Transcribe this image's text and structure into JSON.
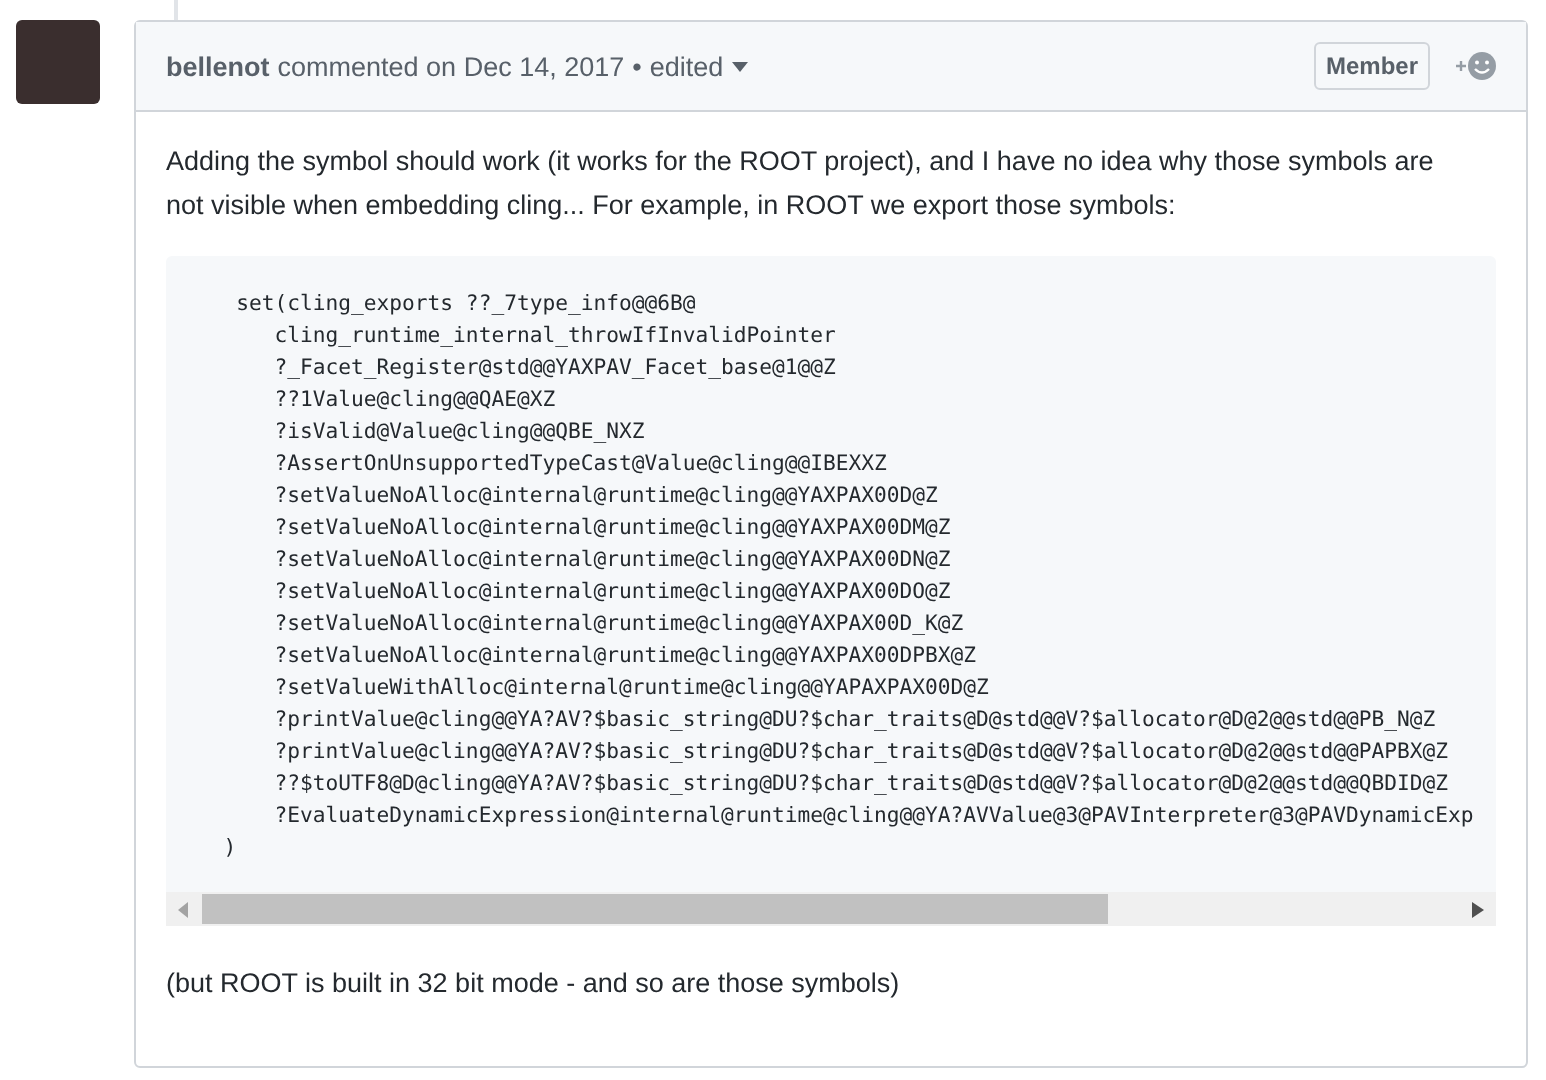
{
  "comment": {
    "author": "bellenot",
    "action": "commented on Dec 14, 2017",
    "separator": "•",
    "edited": "edited",
    "badge": "Member",
    "body_intro": "Adding the symbol should work (it works for the ROOT project), and I have no idea why those symbols are not visible when embedding cling... For example, in ROOT we export those symbols:",
    "code": "   set(cling_exports ??_7type_info@@6B@\n      cling_runtime_internal_throwIfInvalidPointer\n      ?_Facet_Register@std@@YAXPAV_Facet_base@1@@Z\n      ??1Value@cling@@QAE@XZ\n      ?isValid@Value@cling@@QBE_NXZ\n      ?AssertOnUnsupportedTypeCast@Value@cling@@IBEXXZ\n      ?setValueNoAlloc@internal@runtime@cling@@YAXPAX00D@Z\n      ?setValueNoAlloc@internal@runtime@cling@@YAXPAX00DM@Z\n      ?setValueNoAlloc@internal@runtime@cling@@YAXPAX00DN@Z\n      ?setValueNoAlloc@internal@runtime@cling@@YAXPAX00DO@Z\n      ?setValueNoAlloc@internal@runtime@cling@@YAXPAX00D_K@Z\n      ?setValueNoAlloc@internal@runtime@cling@@YAXPAX00DPBX@Z\n      ?setValueWithAlloc@internal@runtime@cling@@YAPAXPAX00D@Z\n      ?printValue@cling@@YA?AV?$basic_string@DU?$char_traits@D@std@@V?$allocator@D@2@@std@@PB_N@Z\n      ?printValue@cling@@YA?AV?$basic_string@DU?$char_traits@D@std@@V?$allocator@D@2@@std@@PAPBX@Z\n      ??$toUTF8@D@cling@@YA?AV?$basic_string@DU?$char_traits@D@std@@V?$allocator@D@2@@std@@QBDID@Z\n      ?EvaluateDynamicExpression@internal@runtime@cling@@YA?AVValue@3@PAVInterpreter@3@PAVDynamicExp\n  )",
    "body_outro": "(but ROOT is built in 32 bit mode - and so are those symbols)"
  }
}
